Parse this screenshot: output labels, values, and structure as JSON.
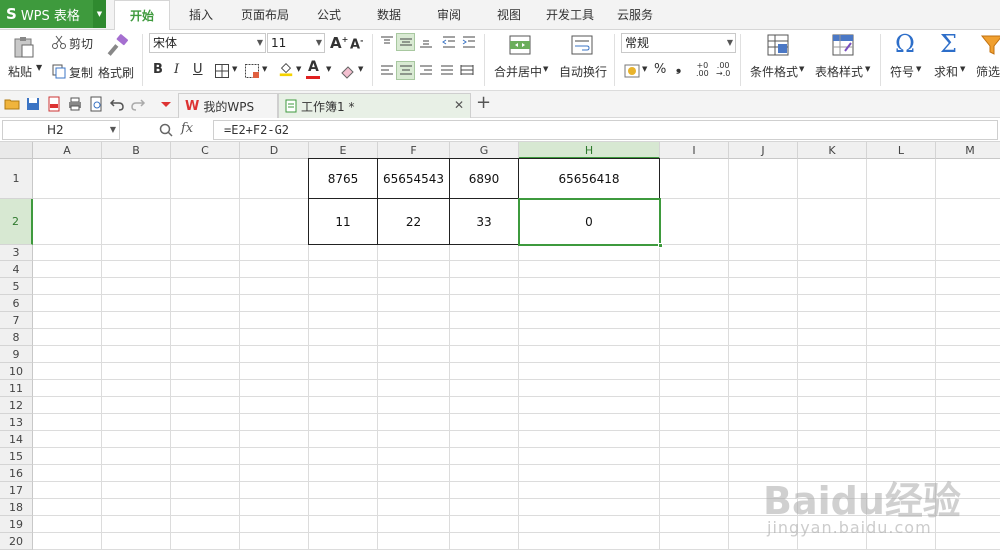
{
  "app": {
    "logo": "S",
    "name": "WPS 表格"
  },
  "menu_tabs": [
    {
      "label": "开始",
      "active": true
    },
    {
      "label": "插入"
    },
    {
      "label": "页面布局"
    },
    {
      "label": "公式"
    },
    {
      "label": "数据"
    },
    {
      "label": "审阅"
    },
    {
      "label": "视图"
    },
    {
      "label": "开发工具"
    },
    {
      "label": "云服务"
    }
  ],
  "ribbon": {
    "paste": "粘贴",
    "cut": "剪切",
    "copy": "复制",
    "format_painter": "格式刷",
    "font_name": "宋体",
    "font_size": "11",
    "bold": "B",
    "italic": "I",
    "underline": "U",
    "merge_center": "合并居中",
    "wrap_text": "自动换行",
    "number_format": "常规",
    "percent": "%",
    "comma": "❟",
    "conditional_format": "条件格式",
    "table_style": "表格样式",
    "symbol": "符号",
    "sum": "求和",
    "filter": "筛选",
    "font_color": "#e02020",
    "fill_color": "#f5d300"
  },
  "quick_access": {
    "tabs": [
      {
        "label": "我的WPS"
      },
      {
        "label": "工作簿1 *",
        "active": true
      }
    ],
    "new_tab": "+"
  },
  "formula_bar": {
    "name_box": "H2",
    "fx": "fx",
    "formula": "=E2+F2-G2"
  },
  "sheet": {
    "columns": [
      "A",
      "B",
      "C",
      "D",
      "E",
      "F",
      "G",
      "H",
      "I",
      "J",
      "K",
      "L",
      "M"
    ],
    "selected_column": "H",
    "rows": [
      "1",
      "2",
      "3",
      "4",
      "5",
      "6",
      "7",
      "8",
      "9",
      "10",
      "11",
      "12",
      "13",
      "14",
      "15",
      "16",
      "17",
      "18",
      "19",
      "20"
    ],
    "selected_row": "2",
    "cells": {
      "E1": "8765",
      "F1": "65654543",
      "G1": "6890",
      "H1": "65656418",
      "E2": "11",
      "F2": "22",
      "G2": "33",
      "H2": "0"
    },
    "accent": "#3e9a3d"
  },
  "watermark": {
    "line1": "Baidu经验",
    "line2": "jingyan.baidu.com"
  }
}
